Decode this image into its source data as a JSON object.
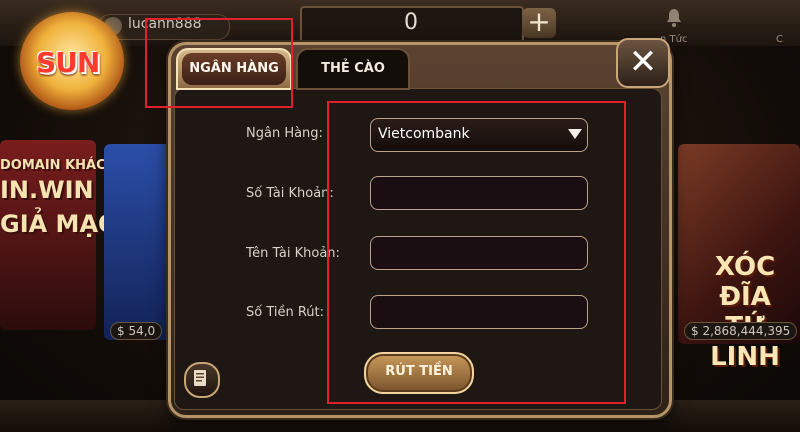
{
  "topbar": {
    "username": "lucann888",
    "balance": "0",
    "add_symbol": "+",
    "news_label": "n Tức",
    "right_label": "C"
  },
  "logo": {
    "text": "SUN"
  },
  "background_cards": {
    "left_lines": [
      "DOMAIN KHÁC",
      "IN.WIN",
      "GIẢ MẠO"
    ],
    "left_jackpot": "54,0",
    "right_title_line1": "XÓC ĐĨA",
    "right_title_line2": "TỨ LINH",
    "right_jackpot": "2,868,444,395"
  },
  "dialog": {
    "tabs": [
      {
        "label": "NGÂN HÀNG",
        "active": true
      },
      {
        "label": "THẺ CÀO",
        "active": false
      }
    ],
    "close_symbol": "✕",
    "form": {
      "bank_label": "Ngân Hàng:",
      "bank_value": "Vietcombank",
      "account_number_label": "Số Tài Khoản:",
      "account_number_value": "",
      "account_name_label": "Tên Tài Khoản:",
      "account_name_value": "",
      "amount_label": "Số Tiền Rút:",
      "amount_value": ""
    },
    "withdraw_button": "RÚT TIỀN"
  },
  "colors": {
    "annotation": "#e0202a",
    "gold_border": "#b79465",
    "panel": "#1f1714"
  }
}
